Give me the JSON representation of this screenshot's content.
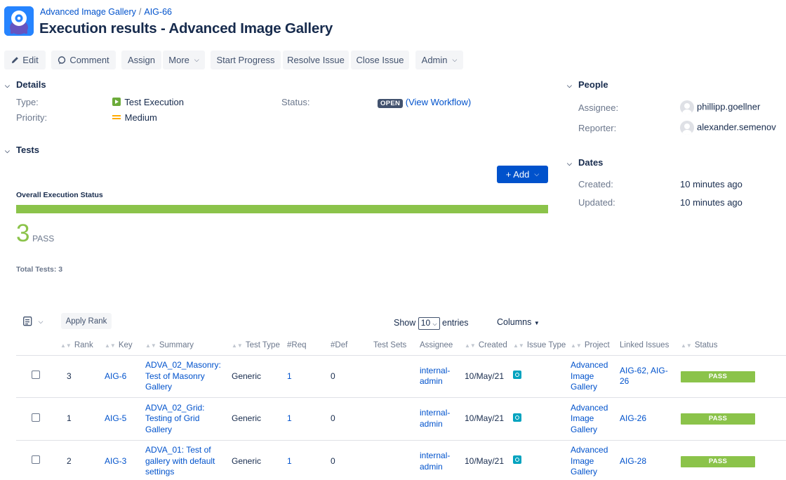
{
  "header": {
    "breadcrumb_project": "Advanced Image Gallery",
    "breadcrumb_sep": "/",
    "breadcrumb_issue": "AIG-66",
    "title": "Execution results - Advanced Image Gallery"
  },
  "toolbar": {
    "edit": "Edit",
    "comment": "Comment",
    "assign": "Assign",
    "more": "More",
    "start_progress": "Start Progress",
    "resolve_issue": "Resolve Issue",
    "close_issue": "Close Issue",
    "admin": "Admin"
  },
  "details": {
    "heading": "Details",
    "type_label": "Type:",
    "type_value": "Test Execution",
    "priority_label": "Priority:",
    "priority_value": "Medium",
    "status_label": "Status:",
    "status_value": "OPEN",
    "view_workflow_open": "(",
    "view_workflow": "View Workflow",
    "view_workflow_close": ")"
  },
  "people": {
    "heading": "People",
    "assignee_label": "Assignee:",
    "assignee_value": "phillipp.goellner",
    "reporter_label": "Reporter:",
    "reporter_value": "alexander.semenov"
  },
  "dates": {
    "heading": "Dates",
    "created_label": "Created:",
    "created_value": "10 minutes ago",
    "updated_label": "Updated:",
    "updated_value": "10 minutes ago"
  },
  "tests": {
    "heading": "Tests",
    "add_label": "+ Add",
    "overall_label": "Overall Execution Status",
    "pass_fraction": 1.0,
    "pass_count": "3",
    "pass_word": "PASS",
    "total_label": "Total Tests: 3"
  },
  "table": {
    "apply_rank": "Apply Rank",
    "show_label": "Show",
    "show_value": "10",
    "entries_label": "entries",
    "columns_label": "Columns",
    "headers": [
      "Rank",
      "Key",
      "Summary",
      "Test Type",
      "#Req",
      "#Def",
      "Test Sets",
      "Assignee",
      "Created",
      "Issue Type",
      "Project",
      "Linked Issues",
      "Status"
    ],
    "rows": [
      {
        "rank": "3",
        "key": "AIG-6",
        "summary": "ADVA_02_Masonry: Test of Masonry Gallery",
        "test_type": "Generic",
        "req": "1",
        "def": "0",
        "test_sets": "",
        "assignee": "internal-admin",
        "created": "10/May/21",
        "project": "Advanced Image Gallery",
        "linked": "AIG-62, AIG-26",
        "status": "PASS"
      },
      {
        "rank": "1",
        "key": "AIG-5",
        "summary": "ADVA_02_Grid: Testing of Grid Gallery",
        "test_type": "Generic",
        "req": "1",
        "def": "0",
        "test_sets": "",
        "assignee": "internal-admin",
        "created": "10/May/21",
        "project": "Advanced Image Gallery",
        "linked": "AIG-26",
        "status": "PASS"
      },
      {
        "rank": "2",
        "key": "AIG-3",
        "summary": "ADVA_01: Test of gallery with default settings",
        "test_type": "Generic",
        "req": "1",
        "def": "0",
        "test_sets": "",
        "assignee": "internal-admin",
        "created": "10/May/21",
        "project": "Advanced Image Gallery",
        "linked": "AIG-28",
        "status": "PASS"
      }
    ]
  },
  "colors": {
    "brand": "#0052cc",
    "pass": "#8bc34a",
    "open_lozenge": "#42526e"
  }
}
